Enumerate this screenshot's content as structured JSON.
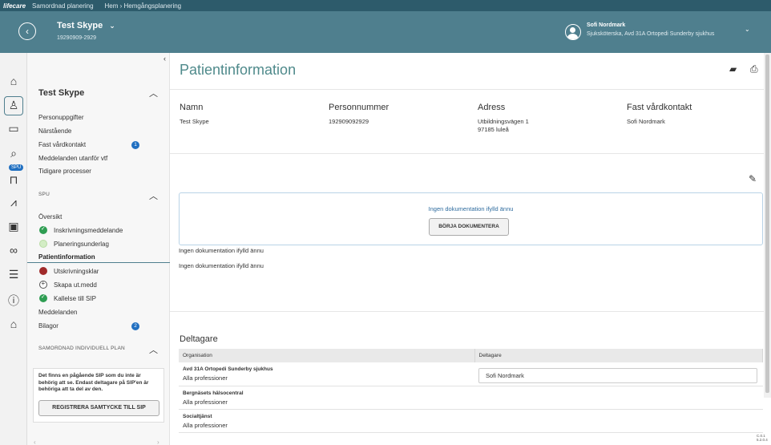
{
  "topbar": {
    "logo": "lifecare",
    "app": "Samordnad planering",
    "breadcrumb": "Hem › Hemgångsplanering"
  },
  "patient": {
    "name": "Test Skype",
    "pnr": "19290909-2929"
  },
  "user": {
    "name": "Sofi Nordmark",
    "role": "Sjuksköterska, Avd 31A Ortopedi Sunderby sjukhus"
  },
  "rail": {
    "spu_badge": "SPU"
  },
  "nav": {
    "collapse_glyph": "‹",
    "patient_section": "Test Skype",
    "patient_items": [
      {
        "label": "Personuppgifter"
      },
      {
        "label": "Närstående"
      },
      {
        "label": "Fast vårdkontakt",
        "badge": "1"
      },
      {
        "label": "Meddelanden utanför vtf"
      },
      {
        "label": "Tidigare processer"
      }
    ],
    "spu_section": "SPU",
    "spu_items": [
      {
        "label": "Översikt"
      },
      {
        "label": "Inskrivningsmeddelande",
        "status": "done"
      },
      {
        "label": "Planeringsunderlag",
        "status": "pending"
      },
      {
        "label": "Patientinformation",
        "active": true
      },
      {
        "label": "Utskrivningsklar",
        "status": "red"
      },
      {
        "label": "Skapa ut.medd",
        "status": "plus"
      },
      {
        "label": "Kallelse till SIP",
        "status": "done"
      },
      {
        "label": "Meddelanden"
      },
      {
        "label": "Bilagor",
        "badge": "2"
      }
    ],
    "sip_section": "SAMORDNAD INDIVIDUELL PLAN",
    "sip_text": "Det finns en pågående SIP som du inte är behörig att se. Endast deltagare på SIP'en är behöriga att ta del av den.",
    "sip_button": "REGISTRERA SAMTYCKE TILL SIP"
  },
  "main": {
    "title": "Patientinformation",
    "columns": [
      {
        "header": "Namn",
        "value": "Test Skype"
      },
      {
        "header": "Personnummer",
        "value": "192909092929"
      },
      {
        "header": "Adress",
        "value": "Utbildningsvägen 1\n97185 luleå"
      },
      {
        "header": "Fast vårdkontakt",
        "value": "Sofi Nordmark"
      }
    ],
    "doc_message": "Ingen dokumentation ifylld ännu",
    "doc_button": "BÖRJA DOKUMENTERA",
    "nodoc_1": "Ingen dokumentation ifylld ännu",
    "nodoc_2": "Ingen dokumentation ifylld ännu",
    "participants_title": "Deltagare",
    "table": {
      "headers": [
        "Organisation",
        "Deltagare"
      ],
      "rows": [
        {
          "org": "Avd 31A Ortopedi Sunderby sjukhus",
          "prof": "Alla professioner",
          "participant": "Sofi Nordmark"
        },
        {
          "org": "Bergnäsets hälsocentral",
          "prof": "Alla professioner",
          "participant": ""
        },
        {
          "org": "Socialtjänst",
          "prof": "Alla professioner",
          "participant": ""
        }
      ]
    }
  },
  "version": "C.0.1\n5.2.0.4"
}
